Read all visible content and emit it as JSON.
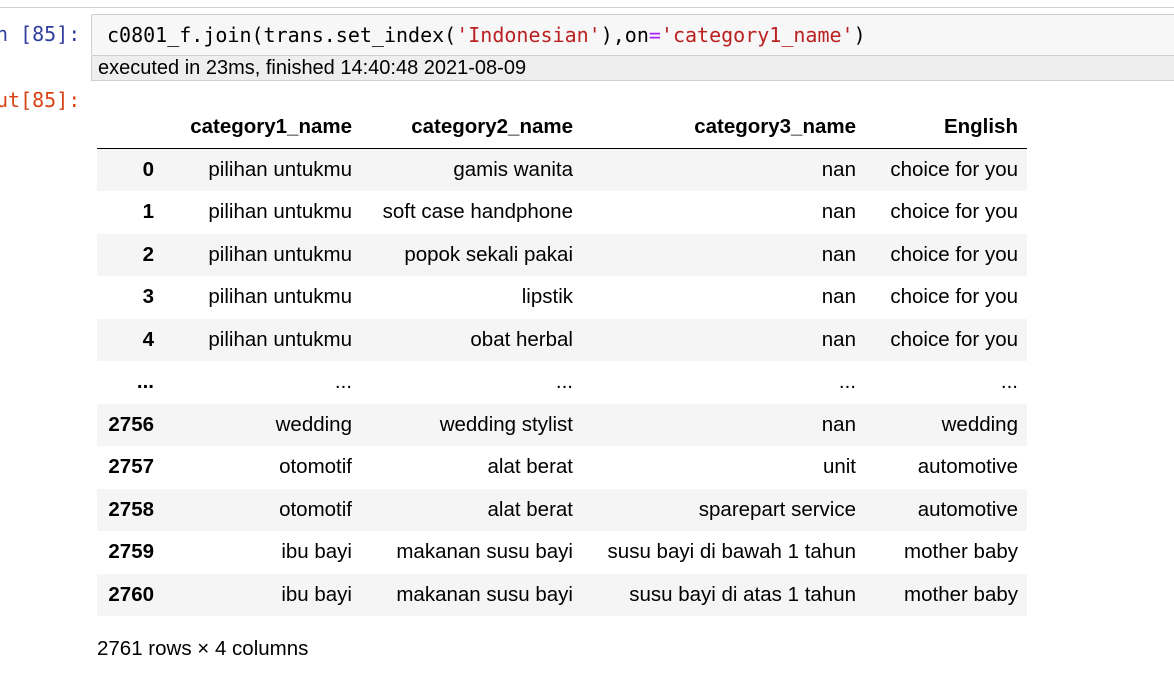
{
  "cell": {
    "in_prompt": "n [85]:",
    "out_prompt": "ut[85]:",
    "code": {
      "p1": "c0801_f.join(trans.set_index(",
      "s1": "'Indonesian'",
      "p2": "),on",
      "eq": "=",
      "s2": "'category1_name'",
      "p3": ")"
    },
    "exec_info": "executed in 23ms, finished 14:40:48 2021-08-09"
  },
  "table": {
    "columns": [
      "",
      "category1_name",
      "category2_name",
      "category3_name",
      "English"
    ],
    "rows": [
      [
        "0",
        "pilihan untukmu",
        "gamis wanita",
        "nan",
        "choice for you"
      ],
      [
        "1",
        "pilihan untukmu",
        "soft case handphone",
        "nan",
        "choice for you"
      ],
      [
        "2",
        "pilihan untukmu",
        "popok sekali pakai",
        "nan",
        "choice for you"
      ],
      [
        "3",
        "pilihan untukmu",
        "lipstik",
        "nan",
        "choice for you"
      ],
      [
        "4",
        "pilihan untukmu",
        "obat herbal",
        "nan",
        "choice for you"
      ],
      [
        "...",
        "...",
        "...",
        "...",
        "..."
      ],
      [
        "2756",
        "wedding",
        "wedding stylist",
        "nan",
        "wedding"
      ],
      [
        "2757",
        "otomotif",
        "alat berat",
        "unit",
        "automotive"
      ],
      [
        "2758",
        "otomotif",
        "alat berat",
        "sparepart service",
        "automotive"
      ],
      [
        "2759",
        "ibu bayi",
        "makanan susu bayi",
        "susu bayi di bawah 1 tahun",
        "mother baby"
      ],
      [
        "2760",
        "ibu bayi",
        "makanan susu bayi",
        "susu bayi di atas 1 tahun",
        "mother baby"
      ]
    ],
    "shape": "2761 rows × 4 columns"
  }
}
